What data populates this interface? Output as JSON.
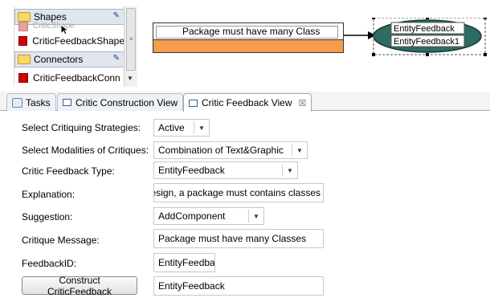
{
  "palette": {
    "drawers": [
      {
        "label": "Shapes"
      },
      {
        "label": "Connectors"
      }
    ],
    "entries": [
      {
        "label": "CriticShape"
      },
      {
        "label": "CriticFeedbackShape"
      },
      {
        "label": "CriticFeedbackConn"
      }
    ]
  },
  "diagram": {
    "package_node_label": "Package must have many Class",
    "entity_node_labels": [
      "EntityFeedback",
      "EntityFeedback1"
    ]
  },
  "tabs": [
    {
      "label": "Tasks",
      "icon": "tasks-icon",
      "active": false
    },
    {
      "label": "Critic Construction View",
      "icon": "view-icon",
      "active": false
    },
    {
      "label": "Critic Feedback View",
      "icon": "view-icon",
      "active": true,
      "close_glyph": "☒"
    }
  ],
  "form": {
    "strategies": {
      "label": "Select Critiquing Strategies:",
      "value": "Active"
    },
    "modalities": {
      "label": "Select Modalities of Critiques:",
      "value": "Combination of Text&Graphic"
    },
    "feedback_type": {
      "label": "Critic Feedback Type:",
      "value": "EntityFeedback"
    },
    "explanation": {
      "label": "Explanation:",
      "value": "esign, a package must contains classes"
    },
    "suggestion": {
      "label": "Suggestion:",
      "value": "AddComponent"
    },
    "critique_message": {
      "label": "Critique Message:",
      "value": "Package must have many Classes"
    },
    "feedback_id": {
      "label": "FeedbackID:",
      "value": "EntityFeedba"
    },
    "construct_button": "Construct CriticFeedback",
    "construct_value": "EntityFeedback"
  },
  "colors": {
    "package_fill": "#f89c4e",
    "entity_fill": "#2e6b63",
    "accent": "#3a5f95"
  }
}
